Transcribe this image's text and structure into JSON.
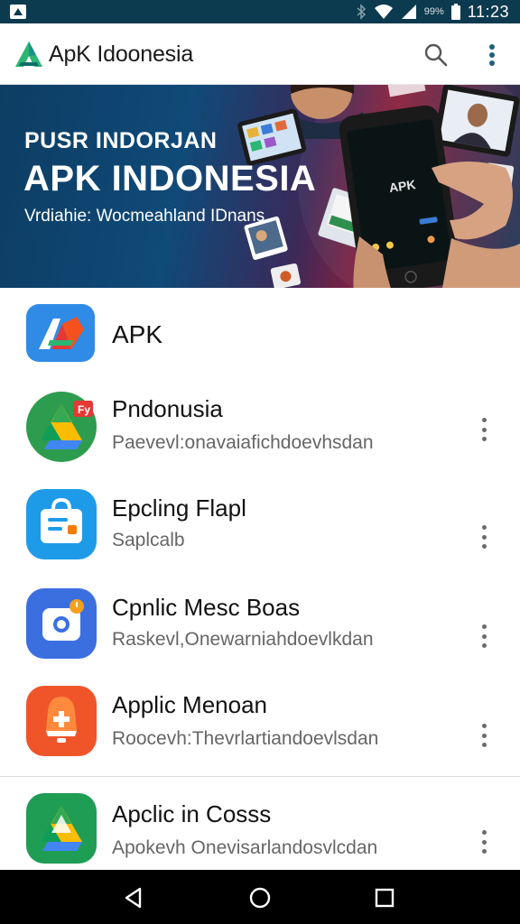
{
  "status_bar": {
    "battery_percent": "99%",
    "time": "11:23",
    "icons": [
      "notification-icon",
      "bluetooth-icon",
      "wifi-icon",
      "signal-icon",
      "battery-icon"
    ]
  },
  "app_bar": {
    "title": "ApK Idoonesia",
    "logo_icon": "apk-logo-icon",
    "search_icon": "search-icon",
    "menu_icon": "more-vert-icon"
  },
  "banner": {
    "kicker": "PUSR INDORJAN",
    "title": "APK INDONESIA",
    "subtitle": "Vrdiahie: Wocmeahland IDnans",
    "phone_label": "APK"
  },
  "apps": [
    {
      "title": "APK",
      "subtitle": "",
      "icon": "apk-app-icon",
      "has_menu": false
    },
    {
      "title": "Pndonusia",
      "subtitle": "Paevevl:onavaiafichdoevhsdan",
      "icon": "drive-app-icon",
      "has_menu": true
    },
    {
      "title": "Epcling Flapl",
      "subtitle": "Saplcalb",
      "icon": "store-app-icon",
      "has_menu": true
    },
    {
      "title": "Cpnlic Mesc Boas",
      "subtitle": "Raskevl,Onewarniahdoevlkdan",
      "icon": "camera-app-icon",
      "has_menu": true
    },
    {
      "title": "Applic Menoan",
      "subtitle": "Roocevh:Thevrlartiandoevlsdan",
      "icon": "alert-app-icon",
      "has_menu": true
    },
    {
      "title": "Apclic in Cosss",
      "subtitle": "Apokevh Onevisarlandosvlcdan",
      "icon": "drive-green-app-icon",
      "has_menu": true
    }
  ],
  "nav_bar": {
    "icons": [
      "back-icon",
      "home-icon",
      "recents-icon"
    ]
  },
  "colors": {
    "status_bar": "#0c3a4e",
    "banner_start": "#0d3d63",
    "banner_accent": "#8a1f3c",
    "text_primary": "#111111",
    "text_secondary": "#666666",
    "nav_bar": "#000000"
  }
}
